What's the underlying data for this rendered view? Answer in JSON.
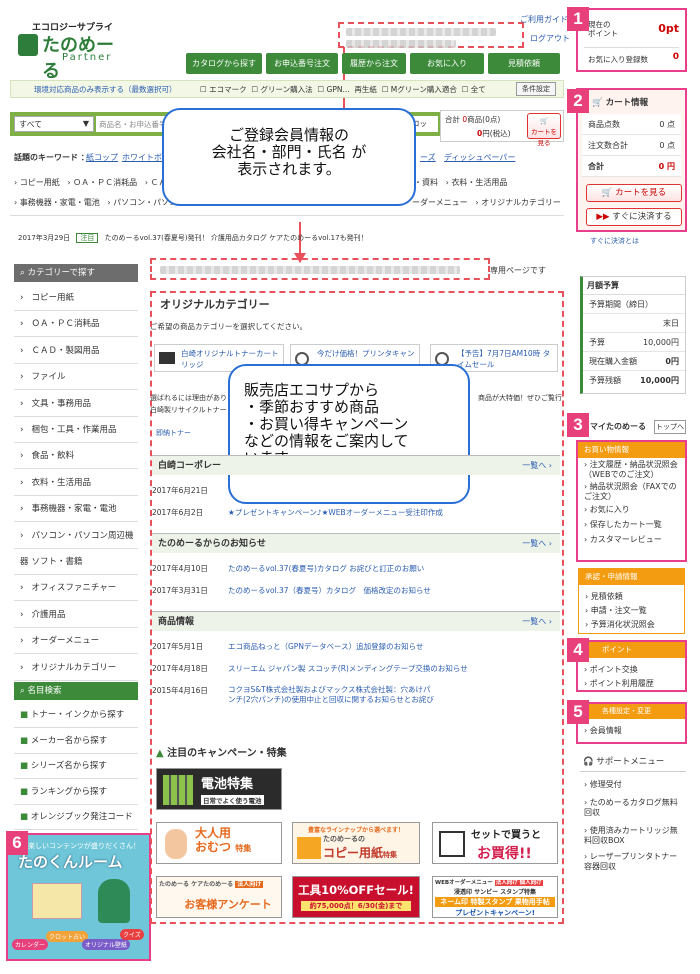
{
  "header": {
    "logo_top": "エコロジーサプライ",
    "logo_main": "たのめーる",
    "logo_sub": "Partner",
    "guide": "ご利用ガイド",
    "logout": "ログアウト",
    "points_label": "現在の",
    "points_label2": "ポイント",
    "points_value": "0pt",
    "fav_label": "お気に入り登録数",
    "fav_value": "0"
  },
  "toolbar": {
    "buttons": [
      "カタログから探す",
      "お申込番号注文",
      "履歴から注文",
      "お気に入り",
      "見積依頼"
    ]
  },
  "filter": {
    "eco_link": "環境対応商品のみ表示する（最数選択可）",
    "checks": [
      "エコマーク",
      "グリーン購入法",
      "GPN...",
      "再生紙",
      "Mグリーン購入適合",
      "全て"
    ],
    "condition_btn": "条件設定"
  },
  "search": {
    "category": "すべて",
    "placeholder": "商品名・お申込番号",
    "btn": "ロッ",
    "cart_label": "合計",
    "cart_count": "0",
    "cart_unit": "商品(0点)",
    "cart_price": "0",
    "cart_price_unit": "円(税込)",
    "cart_btn": "カートを見る"
  },
  "keywords": {
    "label": "話題のキーワード ：",
    "items": [
      "紙コップ",
      "ホワイトボー",
      "ーズ",
      "ディッシュペーパー"
    ]
  },
  "cats_top": [
    "コピー用紙",
    "ＯＡ・ＰＣ消耗品",
    "ＣＡＤ",
    "・資料",
    "衣料・生活用品"
  ],
  "cats_bottom": [
    "事務機器・家電・電池",
    "パソコン・パソコン周",
    "ーダーメニュー",
    "オリジナルカテゴリー"
  ],
  "ticker": {
    "date": "2017年3月29日",
    "badge": "注目",
    "text": "たのめーるvol.37(春夏号)発刊！ 介護用品カタログ ケアたのめーるvol.17も発刊！"
  },
  "sidebar": {
    "title": "カテゴリーで探す",
    "items": [
      "コピー用紙",
      "ＯＡ・ＰＣ消耗品",
      "ＣＡＤ・製図用品",
      "ファイル",
      "文具・事務用品",
      "梱包・工具・作業用品",
      "食品・飲料",
      "衣料・生活用品",
      "事務機器・家電・電池",
      "パソコン・パソコン周辺機器",
      "ソフト・書籍",
      "オフィスファニチャー",
      "介護用品",
      "オーダーメニュー",
      "オリジナルカテゴリー"
    ],
    "search_title": "名目検索",
    "search_items": [
      "トナー・インクから探す",
      "メーカー名から探す",
      "シリーズ名から探す",
      "ランキングから探す",
      "オレンジブック発注コードから探す"
    ],
    "banner": {
      "top": "楽しいコンテンツが盛りだくさん！",
      "title": "たのくんルーム",
      "tags": [
        "カレンダー",
        "クロット占い",
        "オリジナル壁紙",
        "クイズ"
      ]
    }
  },
  "main": {
    "member_suffix": "専用ページです",
    "orig_title": "オリジナルカテゴリー",
    "orig_desc": "ご希望の商品カテゴリーを選択してください。",
    "orig_items": [
      "白崎オリジナルトナーカートリッジ",
      "今だけ価格！プリンタキャン",
      "【予告】7月7日AM10時 タイムセール"
    ],
    "orig_text": "選ばれるには理由があり",
    "orig_text2": "白崎製リサイクルトナー",
    "orig_text3": "商品が大特価！ぜひご覧行",
    "orig_link": "即納トナー",
    "sections": [
      {
        "title": "白崎コーポレー",
        "more": "一覧へ",
        "news": [
          {
            "date": "2017年6月21日",
            "text": ""
          },
          {
            "date": "2017年6月2日",
            "text": "★プレゼントキャンペーン♪★WEBオーダーメニュー受注印作成"
          }
        ]
      },
      {
        "title": "たのめーるからのお知らせ",
        "more": "一覧へ",
        "news": [
          {
            "date": "2017年4月10日",
            "text": "たのめーるvol.37(春夏号)カタログ お詫びと訂正のお願い"
          },
          {
            "date": "2017年3月31日",
            "text": "たのめーるvol.37（春夏号）カタログ　価格改定のお知らせ"
          }
        ]
      },
      {
        "title": "商品情報",
        "more": "一覧へ",
        "news": [
          {
            "date": "2017年5月1日",
            "text": "エコ商品ねっと（GPNデータベース）追加登録のお知らせ"
          },
          {
            "date": "2017年4月18日",
            "text": "スリーエム ジャパン製 スコッチ(R)メンディングテープ交換のお知らせ"
          },
          {
            "date": "2015年4月16日",
            "text": "コクヨS&T株式会社製およびマックス株式会社製：穴あけパンチ(2穴パンチ)の使用中止と回収に関するお知らせとお詫び"
          }
        ]
      }
    ],
    "campaign_title": "注目のキャンペーン・特集",
    "banners": {
      "battery": "電池特集",
      "battery_sub": "日常でよく使う電池",
      "diaper_l1": "大人用",
      "diaper_l2": "おむつ",
      "diaper_l3": "特集",
      "copy_top": "豊富なラインナップから選べます！",
      "copy_l1": "たのめーるの",
      "copy_l2": "コピー用紙",
      "copy_l3": "特集",
      "set_l1": "セットで買うと",
      "set_l2": "お買得!!",
      "survey_top": "たのめーる ケアたのめーる",
      "survey_tag": "法人向け",
      "survey_main": "お客様アンケート",
      "sale_l1": "工具10%OFFセール!",
      "sale_l2": "約75,000点！6/30(金)まで",
      "web_top": "WEBオーダーメニュー",
      "web_tag": "法人向け 個人向け",
      "web_sub": "浸透印 サンビー スタンプ特集",
      "web_main": "ネーム印 特製スタンプ 果物用手帖",
      "web_foot": "プレゼントキャンペーン!"
    }
  },
  "cart_panel": {
    "title": "カート情報",
    "rows": [
      {
        "label": "商品点数",
        "value": "0 点"
      },
      {
        "label": "注文数合計",
        "value": "0 点"
      },
      {
        "label": "合計",
        "value": "0 円"
      }
    ],
    "view_btn": "カートを見る",
    "checkout_btn": "すぐに決済する",
    "after": "すぐに決済とは"
  },
  "budget_panel": {
    "title": "月額予算",
    "rows": [
      {
        "label": "予算期間（締日）",
        "value": ""
      },
      {
        "label": "",
        "value": "末日"
      },
      {
        "label": "予算",
        "value": "10,000円"
      },
      {
        "label": "現在購入金額",
        "value": "0円"
      },
      {
        "label": "予算残額",
        "value": "10,000円"
      }
    ]
  },
  "my_panel": {
    "title": "マイたのめーる",
    "top_btn": "トップへ",
    "sub1": "お買い物情報",
    "items1": [
      "注文履歴・納品状況照会（WEBでのご注文）",
      "納品状況照会（FAXでのご注文）",
      "お気に入り",
      "保存したカート一覧",
      "カスタマーレビュー"
    ],
    "sub2": "承認・申請情報",
    "items2": [
      "見積依頼",
      "申請・注文一覧",
      "予算消化状況照会"
    ],
    "sub3": "ポイント",
    "items3": [
      "ポイント交換",
      "ポイント利用履歴"
    ],
    "sub4": "各種設定・変更",
    "items4": [
      "会員情報"
    ]
  },
  "support": {
    "title": "サポートメニュー",
    "items": [
      "修理受付",
      "たのめーるカタログ無料回収",
      "使用済みカートリッジ無料回収BOX",
      "レーザープリンタトナー容器回収"
    ]
  },
  "callouts": {
    "c1_l1": "ご登録会員情報の",
    "c1_l2": "会社名・部門・氏名  が",
    "c1_l3": "表示されます。",
    "c2_l1": "販売店エコサプから",
    "c2_l2": "・季節おすすめ商品",
    "c2_l3": "・お買い得キャンペーン",
    "c2_l4": "などの情報をご案内して",
    "c2_l5": "います。"
  },
  "numbers": [
    "1",
    "2",
    "3",
    "4",
    "5",
    "6"
  ]
}
